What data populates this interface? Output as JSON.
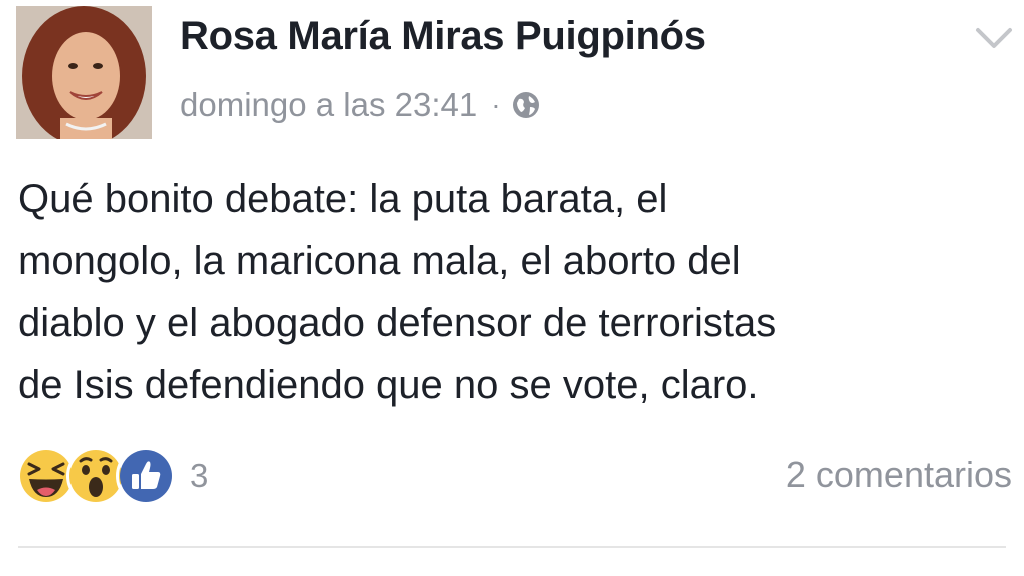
{
  "post": {
    "author": "Rosa María Miras Puigpinós",
    "timestamp": "domingo a las 23:41",
    "separator": "·",
    "privacy_icon": "globe-icon",
    "menu_icon": "chevron-down-icon",
    "text_lines": [
      "Qué bonito debate: la puta barata, el",
      "mongolo, la maricona mala, el aborto del",
      "diablo y el abogado defensor de terroristas",
      "de Isis defendiendo que no se vote, claro."
    ]
  },
  "reactions": {
    "icons": [
      "haha-icon",
      "wow-icon",
      "like-icon"
    ],
    "count": "3",
    "comments": "2 comentarios"
  },
  "colors": {
    "text": "#1d2129",
    "muted": "#90949c",
    "like_blue": "#4267b2",
    "emoji_yellow": "#f7c948"
  }
}
